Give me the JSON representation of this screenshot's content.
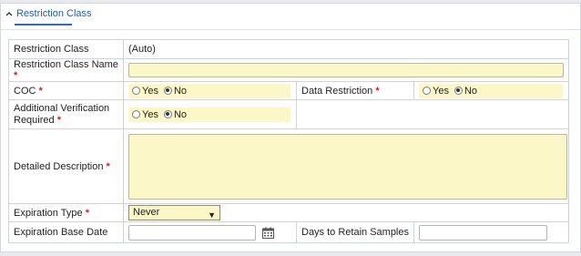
{
  "section": {
    "title": "Restriction Class"
  },
  "form": {
    "restriction_class_label": "Restriction Class",
    "restriction_class_value": "(Auto)",
    "restriction_class_name_label": "Restriction Class Name",
    "coc_label": "COC",
    "coc_options": {
      "yes": "Yes",
      "no": "No",
      "selected": "No"
    },
    "data_restriction_label": "Data Restriction",
    "data_restriction_options": {
      "yes": "Yes",
      "no": "No",
      "selected": "No"
    },
    "additional_verification_label": "Additional Verification Required",
    "additional_verification_options": {
      "yes": "Yes",
      "no": "No",
      "selected": "No"
    },
    "detailed_description_label": "Detailed Description",
    "expiration_type_label": "Expiration Type",
    "expiration_type_value": "Never",
    "expiration_base_date_label": "Expiration Base Date",
    "days_to_retain_label": "Days to Retain Samples",
    "required_marker": "*"
  },
  "icons": {
    "collapse": "chevron-up-icon",
    "calendar": "calendar-icon",
    "dropdown": "triangle-down-icon"
  },
  "colors": {
    "accent": "#1f5fa8",
    "required": "#d21f1f",
    "field_bg": "#fbf7c6"
  }
}
